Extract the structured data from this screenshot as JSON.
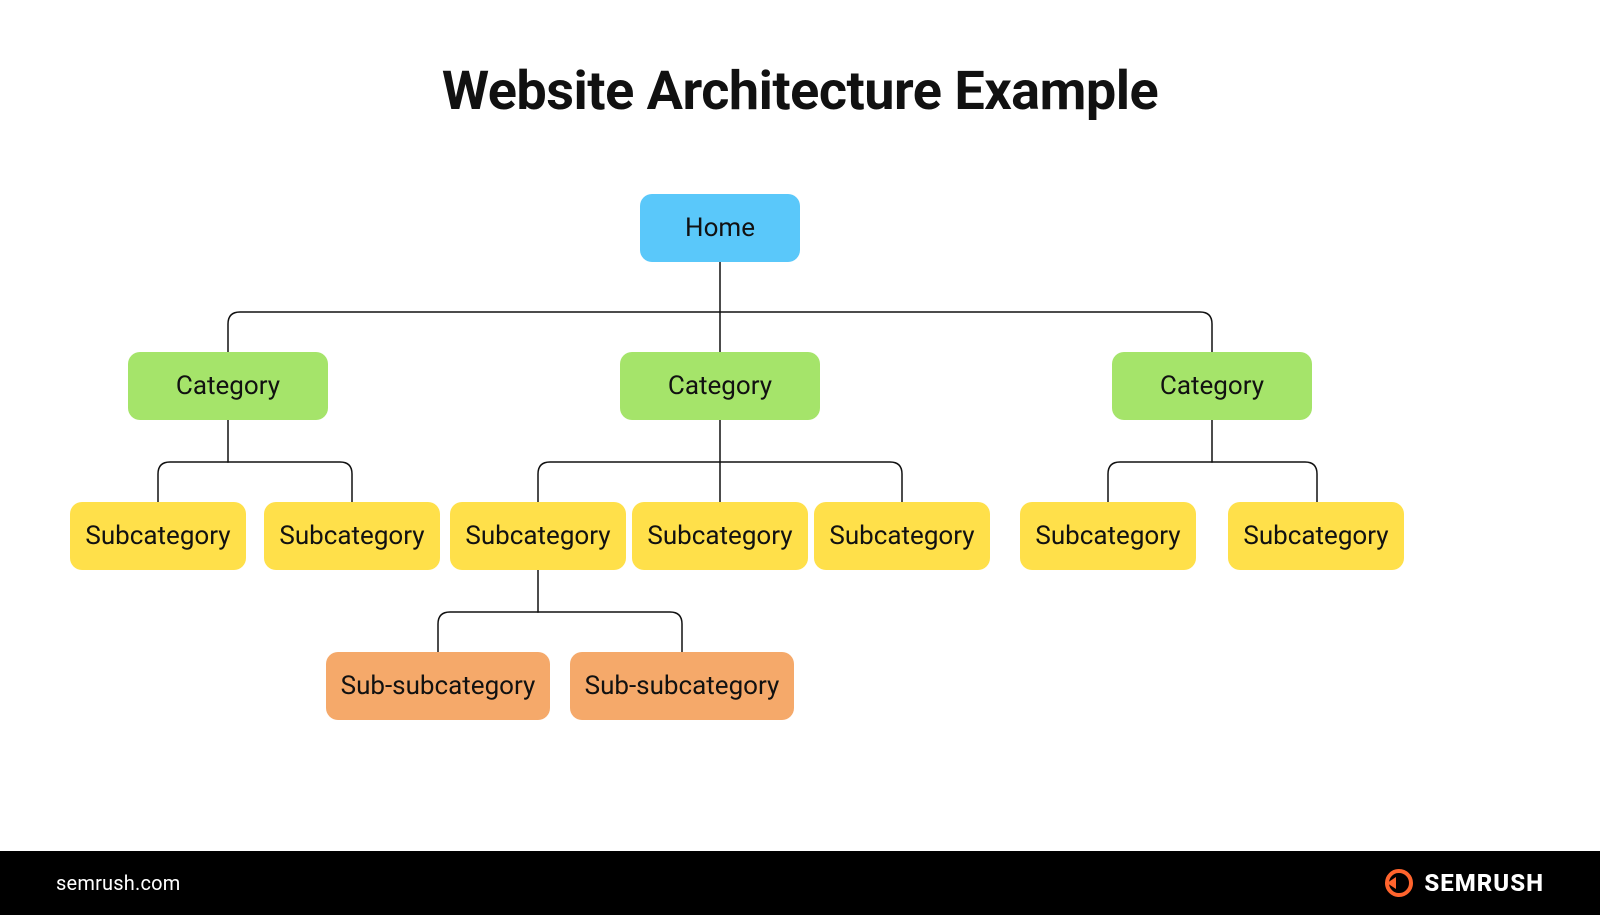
{
  "title": "Website Architecture Example",
  "footer": {
    "left": "semrush.com",
    "brand": "SEMRUSH"
  },
  "colors": {
    "home": "#5ac8fa",
    "category": "#a5e46a",
    "subcategory": "#ffe04a",
    "subsubcategory": "#f5a96a",
    "accent": "#ff642d"
  },
  "tree": {
    "root": {
      "label": "Home",
      "level": 0
    },
    "categories": [
      {
        "label": "Category",
        "subcategories": [
          {
            "label": "Subcategory"
          },
          {
            "label": "Subcategory"
          }
        ]
      },
      {
        "label": "Category",
        "subcategories": [
          {
            "label": "Subcategory",
            "subsubcategories": [
              {
                "label": "Sub-subcategory"
              },
              {
                "label": "Sub-subcategory"
              }
            ]
          },
          {
            "label": "Subcategory"
          },
          {
            "label": "Subcategory"
          }
        ]
      },
      {
        "label": "Category",
        "subcategories": [
          {
            "label": "Subcategory"
          },
          {
            "label": "Subcategory"
          }
        ]
      }
    ]
  }
}
